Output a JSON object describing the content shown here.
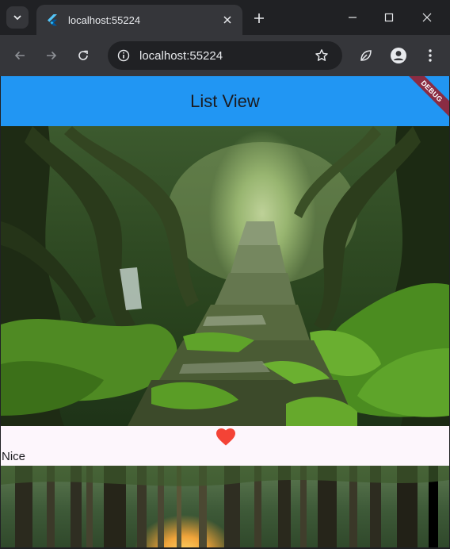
{
  "browser": {
    "tab_title": "localhost:55224",
    "url": "localhost:55224"
  },
  "app": {
    "title": "List View",
    "debug_banner": "DEBUG"
  },
  "list": {
    "items": [
      {
        "label": "Nice",
        "favorited": true
      }
    ]
  },
  "colors": {
    "app_bar": "#2196f3",
    "favorite": "#f44336",
    "debug_ribbon": "#8a2c43",
    "background": "#fdf6fc"
  },
  "icons": {
    "tab_search": "chevron-down-icon",
    "favicon": "flutter-icon",
    "tab_close": "close-icon",
    "new_tab": "plus-icon",
    "back": "arrow-left-icon",
    "forward": "arrow-right-icon",
    "reload": "reload-icon",
    "site_info": "info-icon",
    "bookmark": "star-icon",
    "extension": "leaf-icon",
    "profile": "person-icon",
    "menu": "kebab-menu-icon",
    "favorite": "heart-icon"
  }
}
